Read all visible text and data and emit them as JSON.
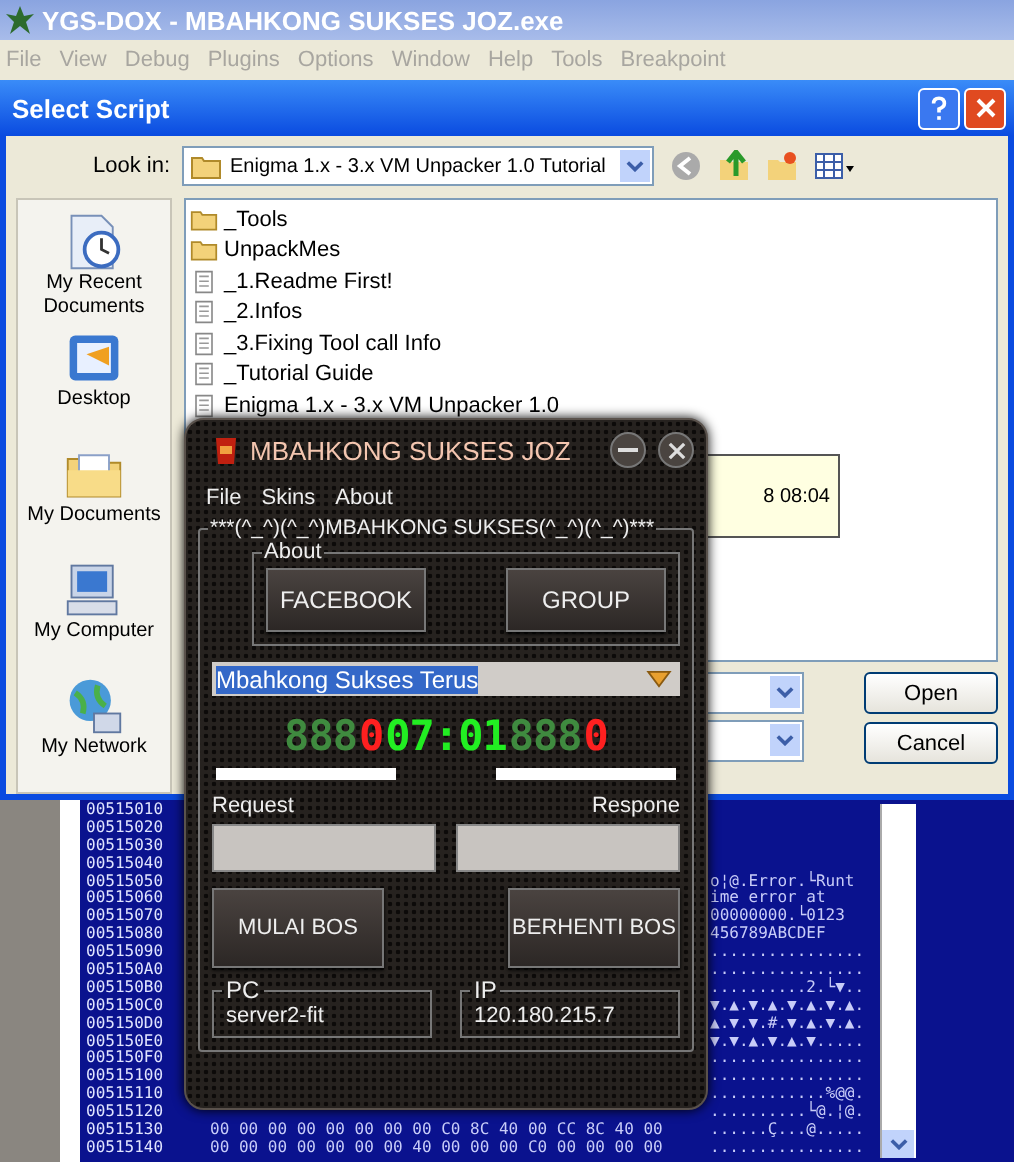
{
  "app_window": {
    "title": "YGS-DOX - MBAHKONG SUKSES JOZ.exe",
    "menu": [
      "File",
      "View",
      "Debug",
      "Plugins",
      "Options",
      "Window",
      "Help",
      "Tools",
      "Breakpoint"
    ]
  },
  "dialog": {
    "title": "Select Script",
    "look_in_label": "Look in:",
    "look_in_value": "Enigma 1.x - 3.x VM Unpacker 1.0 Tutorial",
    "places": [
      {
        "label": "My Recent Documents",
        "kind": "recent"
      },
      {
        "label": "Desktop",
        "kind": "desktop"
      },
      {
        "label": "My Documents",
        "kind": "documents"
      },
      {
        "label": "My Computer",
        "kind": "computer"
      },
      {
        "label": "My Network",
        "kind": "network"
      }
    ],
    "files": [
      {
        "name": "_Tools",
        "kind": "folder"
      },
      {
        "name": "UnpackMes",
        "kind": "folder"
      },
      {
        "name": "_1.Readme First!",
        "kind": "document"
      },
      {
        "name": "_2.Infos",
        "kind": "document"
      },
      {
        "name": "_3.Fixing Tool call Info",
        "kind": "document"
      },
      {
        "name": "_Tutorial Guide",
        "kind": "document"
      },
      {
        "name": "Enigma 1.x - 3.x VM Unpacker 1.0",
        "kind": "document"
      }
    ],
    "tooltip": "8 08:04",
    "buttons": [
      "Open",
      "Cancel"
    ]
  },
  "dump": {
    "rows": [
      {
        "address": "00515010"
      },
      {
        "address": "00515020"
      },
      {
        "address": "00515030"
      },
      {
        "address": "00515040"
      },
      {
        "address": "00515050",
        "ascii": "o¦@.Error.└Runt"
      },
      {
        "address": "00515060",
        "ascii": "ime error     at"
      },
      {
        "address": "00515070",
        "ascii": " 00000000.└0123"
      },
      {
        "address": "00515080",
        "ascii": "456789ABCDEF"
      },
      {
        "address": "00515090",
        "ascii": "................"
      },
      {
        "address": "005150A0",
        "ascii": "................"
      },
      {
        "address": "005150B0",
        "ascii": "..........2.└▼.."
      },
      {
        "address": "005150C0",
        "ascii": "▼.▲.▼.▲.▼.▲.▼.▲."
      },
      {
        "address": "005150D0",
        "ascii": "▲.▼.▼.#.▼.▲.▼.▲."
      },
      {
        "address": "005150E0",
        "ascii": "▼.▼.▲.▼.▲.▼....."
      },
      {
        "address": "005150F0",
        "ascii": "................"
      },
      {
        "address": "00515100",
        "ascii": "................"
      },
      {
        "address": "00515110",
        "ascii": "............%@@."
      },
      {
        "address": "00515120",
        "ascii": "..........└@.¦@."
      },
      {
        "address": "00515130",
        "hex": "00 00 00 00 00 00 00 00 C0 8C 40 00 CC 8C 40 00",
        "ascii": "......Ç...@....."
      },
      {
        "address": "00515140",
        "hex": "00 00 00 00 00 00 00 40 00 00 00 C0 00 00 00 00",
        "ascii": "................"
      }
    ]
  },
  "tool": {
    "title": "MBAHKONG SUKSES JOZ",
    "menu": [
      "File",
      "Skins",
      "About"
    ],
    "group_title": "***(^_^)(^_^)MBAHKONG SUKSES(^_^)(^_^)***",
    "about_label": "About",
    "about_buttons": [
      "FACEBOOK",
      "GROUP"
    ],
    "combo_value": "Mbahkong Sukses Terus",
    "display": [
      {
        "text": "888",
        "kind": "dim"
      },
      {
        "text": "0",
        "kind": "red"
      },
      {
        "text": "07:01",
        "kind": "green"
      },
      {
        "text": "888",
        "kind": "dim"
      },
      {
        "text": "0",
        "kind": "red"
      }
    ],
    "request_label": "Request",
    "response_label": "Respone",
    "action_buttons": [
      "MULAI BOS",
      "BERHENTI BOS"
    ],
    "pc_label": "PC",
    "pc_value": "server2-fit",
    "ip_label": "IP",
    "ip_value": "120.180.215.7"
  }
}
